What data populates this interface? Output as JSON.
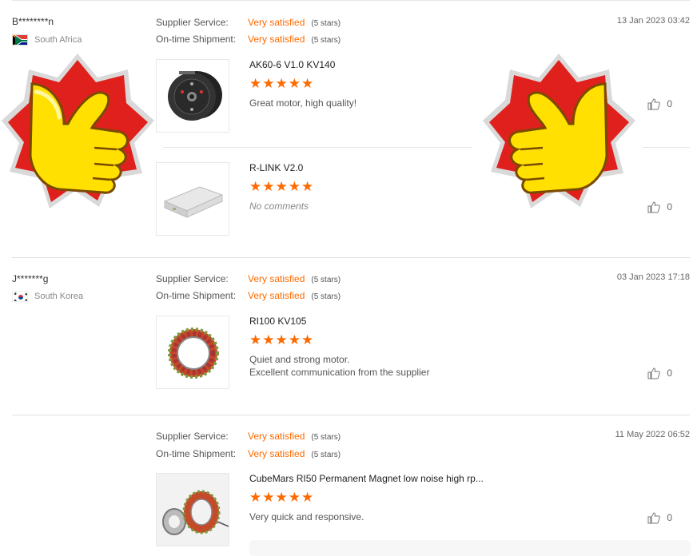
{
  "labels": {
    "supplier_service": "Supplier Service:",
    "ontime_shipment": "On-time Shipment:"
  },
  "colors": {
    "accent": "#ff6a00",
    "badge_red": "#e02020",
    "thumb_yellow": "#ffd400"
  },
  "reviews": [
    {
      "user": "B********n",
      "country": "South Africa",
      "date": "13 Jan 2023 03:42",
      "supplier_service": {
        "value": "Very satisfied",
        "stars_text": "(5 stars)"
      },
      "ontime_shipment": {
        "value": "Very satisfied",
        "stars_text": "(5 stars)"
      },
      "products": [
        {
          "name": "AK60-6 V1.0 KV140",
          "rating": 5,
          "comment": "Great motor, high quality!",
          "likes": "0",
          "image_icon": "motor-black-icon"
        },
        {
          "name": "R-LINK V2.0",
          "rating": 5,
          "comment": "No comments",
          "likes": "0",
          "image_icon": "rlink-box-icon"
        }
      ]
    },
    {
      "user": "J*******g",
      "country": "South Korea",
      "date": "03 Jan 2023 17:18",
      "supplier_service": {
        "value": "Very satisfied",
        "stars_text": "(5 stars)"
      },
      "ontime_shipment": {
        "value": "Very satisfied",
        "stars_text": "(5 stars)"
      },
      "products": [
        {
          "name": "RI100 KV105",
          "rating": 5,
          "comment_lines": [
            "Quiet and strong motor.",
            "Excellent communication from the supplier"
          ],
          "likes": "0",
          "image_icon": "stator-ring-icon"
        }
      ]
    },
    {
      "user": "",
      "country": "",
      "date": "11 May 2022 06:52",
      "supplier_service": {
        "value": "Very satisfied",
        "stars_text": "(5 stars)"
      },
      "ontime_shipment": {
        "value": "Very satisfied",
        "stars_text": "(5 stars)"
      },
      "products": [
        {
          "name": "CubeMars RI50 Permanent Magnet low noise high rp...",
          "rating": 5,
          "comment": "Very quick and responsive.",
          "likes": "0",
          "image_icon": "ri50-motor-icon"
        }
      ]
    }
  ],
  "stars_glyph": "★★★★★"
}
